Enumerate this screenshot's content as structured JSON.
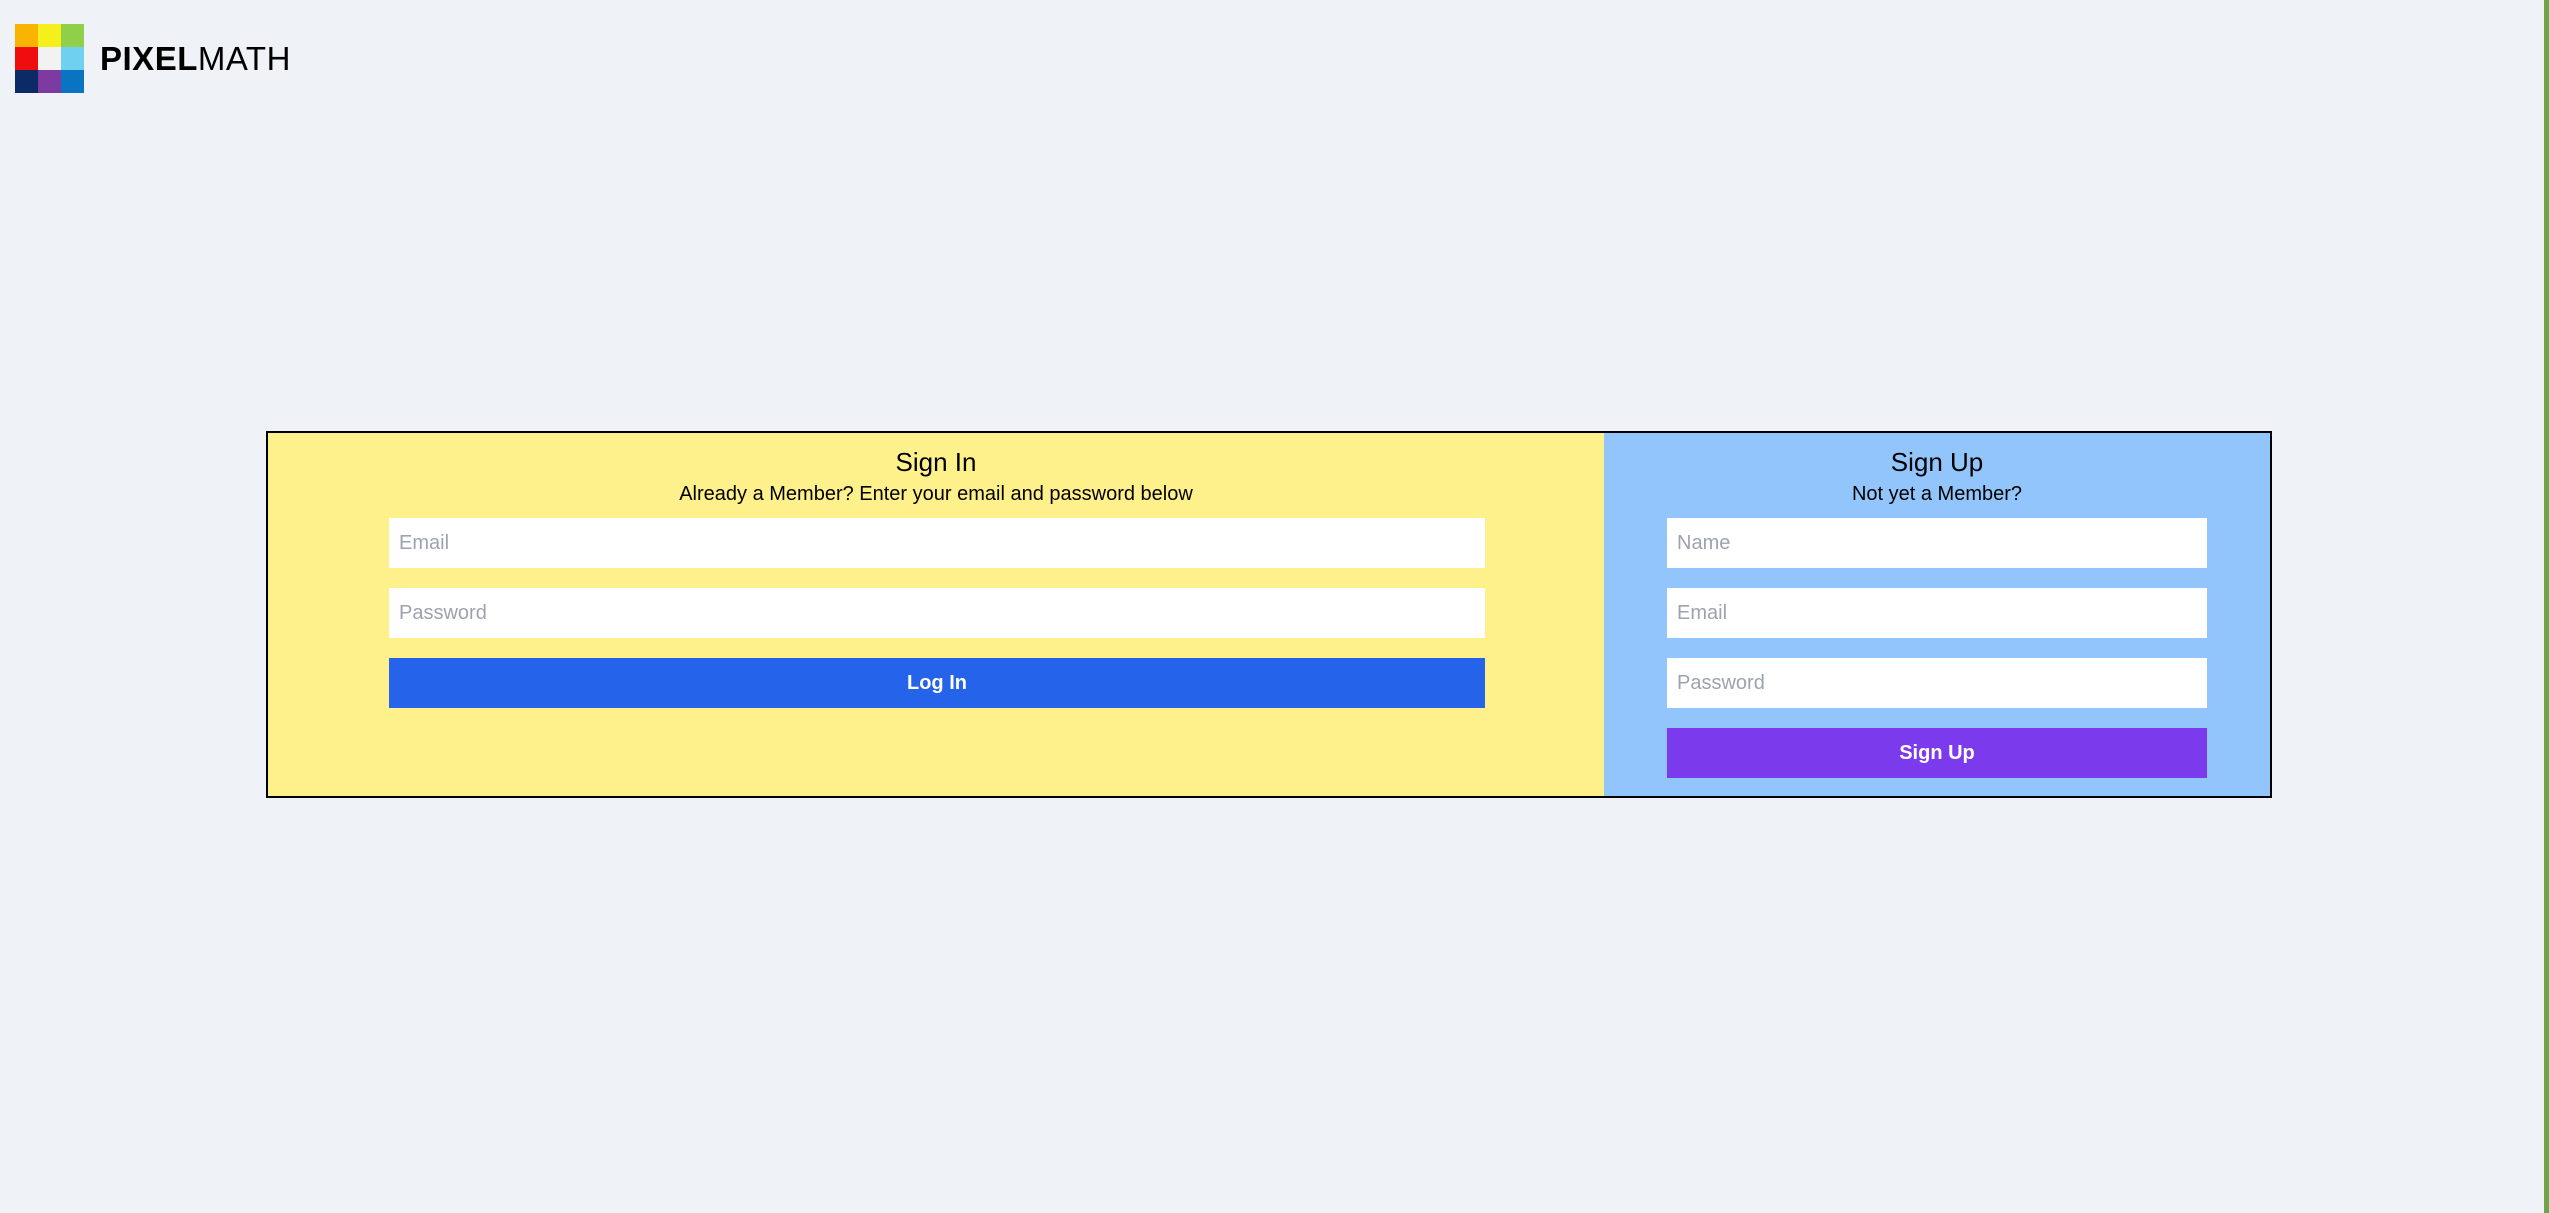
{
  "brand": {
    "name_bold": "PIXEL",
    "name_regular": "MATH",
    "logo_colors": [
      "#f8b400",
      "#f5ef1b",
      "#8fcf4a",
      "#ef0d0d",
      "#f2f2f2",
      "#6fd0ef",
      "#0b2a66",
      "#7d3aa0",
      "#0a74c2"
    ]
  },
  "signin": {
    "title": "Sign In",
    "subtitle": "Already a Member? Enter your email and password below",
    "email_placeholder": "Email",
    "password_placeholder": "Password",
    "button_label": "Log In",
    "bg_color": "#fef08a",
    "button_color": "#2563eb"
  },
  "signup": {
    "title": "Sign Up",
    "subtitle": "Not yet a Member?",
    "name_placeholder": "Name",
    "email_placeholder": "Email",
    "password_placeholder": "Password",
    "button_label": "Sign Up",
    "bg_color": "#93c5fd",
    "button_color": "#7c3aed"
  }
}
